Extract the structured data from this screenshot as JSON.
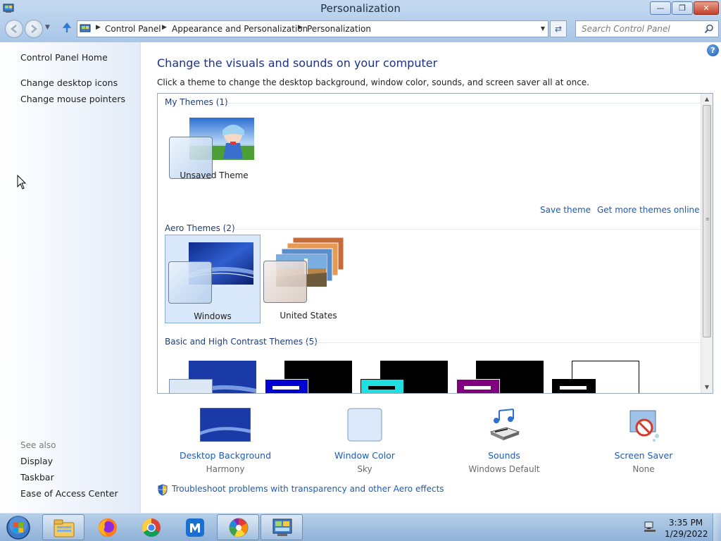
{
  "window": {
    "title": "Personalization",
    "min_label": "—",
    "max_label": "❐",
    "close_label": "✕"
  },
  "address": {
    "crumbs": [
      "Control Panel",
      "Appearance and Personalization",
      "Personalization"
    ]
  },
  "search": {
    "placeholder": "Search Control Panel"
  },
  "sidebar": {
    "home": "Control Panel Home",
    "links": [
      "Change desktop icons",
      "Change mouse pointers"
    ],
    "see_also_title": "See also",
    "see_also": [
      "Display",
      "Taskbar",
      "Ease of Access Center"
    ]
  },
  "main": {
    "help": "?",
    "heading": "Change the visuals and sounds on your computer",
    "subheading": "Click a theme to change the desktop background, window color, sounds, and screen saver all at once.",
    "groups": {
      "my": "My Themes (1)",
      "aero": "Aero Themes (2)",
      "basic": "Basic and High Contrast Themes (5)"
    },
    "themes": {
      "unsaved": "Unsaved Theme",
      "windows": "Windows",
      "united_states": "United States"
    },
    "save_theme": "Save theme",
    "get_more": "Get more themes online",
    "selected_theme": "Windows"
  },
  "bottom": [
    {
      "label": "Desktop Background",
      "value": "Harmony"
    },
    {
      "label": "Window Color",
      "value": "Sky"
    },
    {
      "label": "Sounds",
      "value": "Windows Default"
    },
    {
      "label": "Screen Saver",
      "value": "None"
    }
  ],
  "troubleshoot": "Troubleshoot problems with transparency and other Aero effects",
  "taskbar": {
    "time": "3:35 PM",
    "date": "1/29/2022",
    "apps": [
      "file-explorer-icon",
      "firefox-icon",
      "chrome-icon",
      "maxthon-icon",
      "picasa-icon",
      "control-panel-icon"
    ]
  },
  "colors": {
    "link": "#1e5bb0",
    "heading": "#1e3287",
    "selection": "#d9e8fb"
  }
}
